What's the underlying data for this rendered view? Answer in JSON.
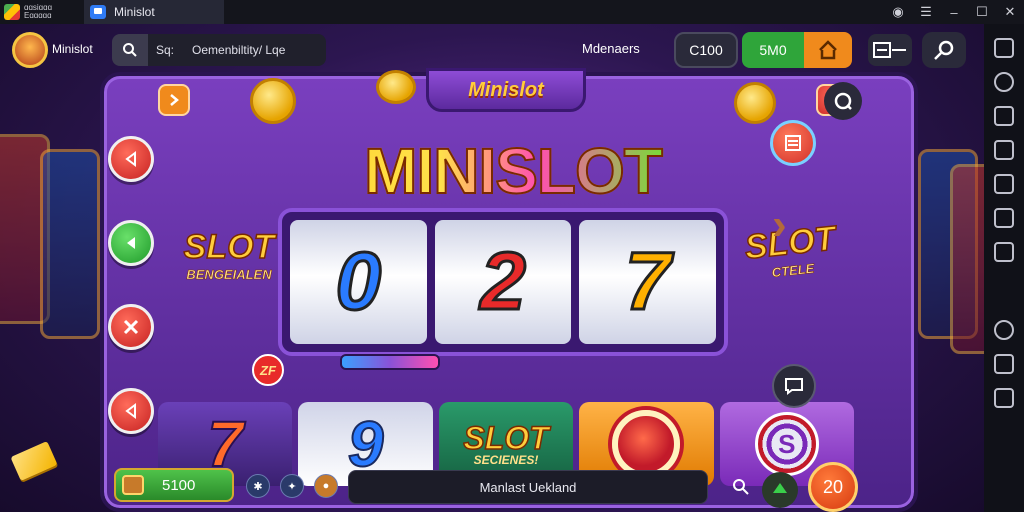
{
  "emulator": {
    "brand_line1": "ɑɑsiɑɑɑ",
    "brand_line2": "Eɑɑɑɑɑ",
    "tab_title": "Minislot",
    "window_controls": [
      "◉",
      "☰",
      "–",
      "☐",
      "✕"
    ]
  },
  "topbar": {
    "profile_name": "Minislot",
    "search_prefix": "Sq:",
    "search_text": "Oemenbiltity/ Lqe",
    "middle_label": "Mdenaers",
    "coins": "C100",
    "green_value": "5M0"
  },
  "game": {
    "banner": "Minislot",
    "logo": "MINISLOT",
    "reels": [
      "0",
      "2",
      "7"
    ],
    "left_promo": {
      "big": "SLOT",
      "small": "BENGEIALEN"
    },
    "right_promo": {
      "big": "SLOT",
      "small": "CTELE"
    },
    "tiles": {
      "t1": "7",
      "t1_badge": "ZF",
      "t2": "9",
      "t3_big": "SLOT",
      "t3_small": "SECIENES!",
      "t5_chip": "S"
    }
  },
  "bottombar": {
    "balance": "5100",
    "status_text": "Manlast Uekland",
    "bet": "20"
  },
  "colors": {
    "accent_green": "#2fa53a",
    "accent_orange": "#f08a1c",
    "panel_purple": "#7a3fbf",
    "side_red": "#c62222"
  }
}
